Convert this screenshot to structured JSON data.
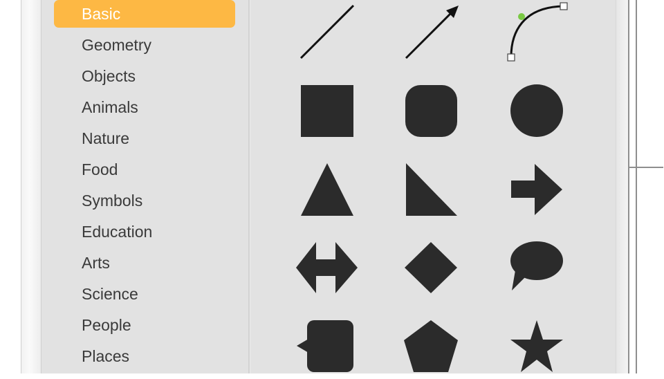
{
  "sidebar": {
    "categories": [
      {
        "label": "Basic",
        "selected": true
      },
      {
        "label": "Geometry"
      },
      {
        "label": "Objects"
      },
      {
        "label": "Animals"
      },
      {
        "label": "Nature"
      },
      {
        "label": "Food"
      },
      {
        "label": "Symbols"
      },
      {
        "label": "Education"
      },
      {
        "label": "Arts"
      },
      {
        "label": "Science"
      },
      {
        "label": "People"
      },
      {
        "label": "Places"
      }
    ]
  },
  "shapes": [
    {
      "name": "line",
      "icon": "line-icon"
    },
    {
      "name": "arrow",
      "icon": "arrow-line-icon"
    },
    {
      "name": "curve",
      "icon": "curve-icon"
    },
    {
      "name": "square",
      "icon": "square-icon"
    },
    {
      "name": "rounded-square",
      "icon": "rounded-square-icon"
    },
    {
      "name": "circle",
      "icon": "circle-icon"
    },
    {
      "name": "triangle",
      "icon": "triangle-icon"
    },
    {
      "name": "right-triangle",
      "icon": "right-triangle-icon"
    },
    {
      "name": "arrow-right",
      "icon": "arrow-right-icon"
    },
    {
      "name": "double-arrow",
      "icon": "double-arrow-icon"
    },
    {
      "name": "diamond",
      "icon": "diamond-icon"
    },
    {
      "name": "speech-bubble",
      "icon": "speech-bubble-icon"
    },
    {
      "name": "callout-square",
      "icon": "callout-square-icon"
    },
    {
      "name": "pentagon",
      "icon": "pentagon-icon"
    },
    {
      "name": "star",
      "icon": "star-icon"
    }
  ],
  "colors": {
    "accent": "#fdb844",
    "shape_fill": "#2b2b2b",
    "curve_handle": "#7ac943"
  }
}
